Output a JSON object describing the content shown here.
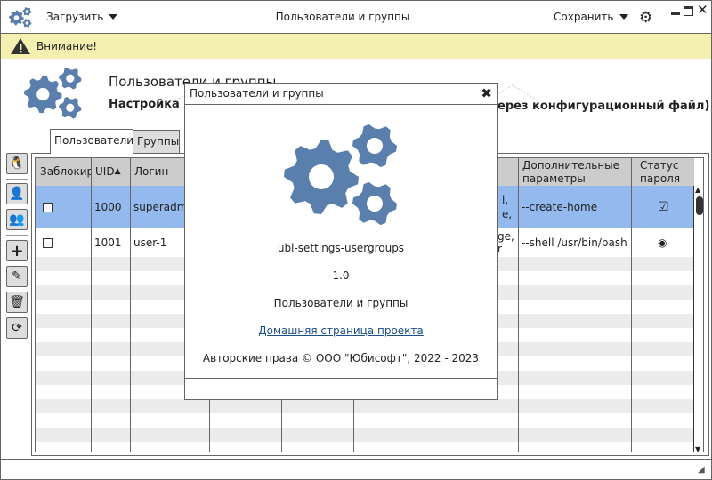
{
  "window": {
    "title": "Пользователи и группы",
    "accent": "#5a7fad"
  },
  "header": {
    "load_menu": "Загрузить",
    "save_menu": "Сохранить",
    "icons": [
      "app-gears-icon",
      "settings-gear-icon",
      "minimize-icon",
      "maximize-icon",
      "close-icon"
    ]
  },
  "warning": {
    "text": "Внимание!"
  },
  "banner": {
    "title": "Пользователи и группы",
    "subtitle_start": "Настройка по",
    "subtitle_end": "ерез конфигурационный файл)"
  },
  "tabs": [
    {
      "label": "Пользователи",
      "active": true
    },
    {
      "label": "Группы",
      "active": false
    }
  ],
  "sidebar": {
    "buttons": [
      "linux-penguin-icon",
      "user-card-icon",
      "users-group-icon",
      "add-icon",
      "edit-icon",
      "trash-icon",
      "refresh-icon"
    ]
  },
  "table": {
    "columns": [
      "Заблокир",
      "UID",
      "Логин",
      "",
      "",
      "",
      "Дополнительные параметры",
      "Статус пароля"
    ],
    "sort": {
      "column": "UID",
      "direction": "ascending"
    },
    "rows": [
      {
        "locked": false,
        "uid": "1000",
        "login": "superadm",
        "groups_fragment_1": "l,",
        "groups_fragment_2": "e,",
        "params": "--create-home",
        "status": "checked",
        "selected": true
      },
      {
        "locked": false,
        "uid": "1001",
        "login": "user-1",
        "groups_fragment_1": "ge,",
        "groups_fragment_2": "r",
        "params": "--shell /usr/bin/bash",
        "status": "radio",
        "selected": false
      }
    ],
    "selected_color": "#93b9ef"
  },
  "dialog": {
    "title": "Пользователи и группы",
    "app_id": "ubl-settings-usergroups",
    "version": "1.0",
    "name": "Пользователи и группы",
    "link": "Домашняя страница проекта",
    "copyright": "Авторские права © ООО \"Юбисофт\", 2022 - 2023"
  }
}
